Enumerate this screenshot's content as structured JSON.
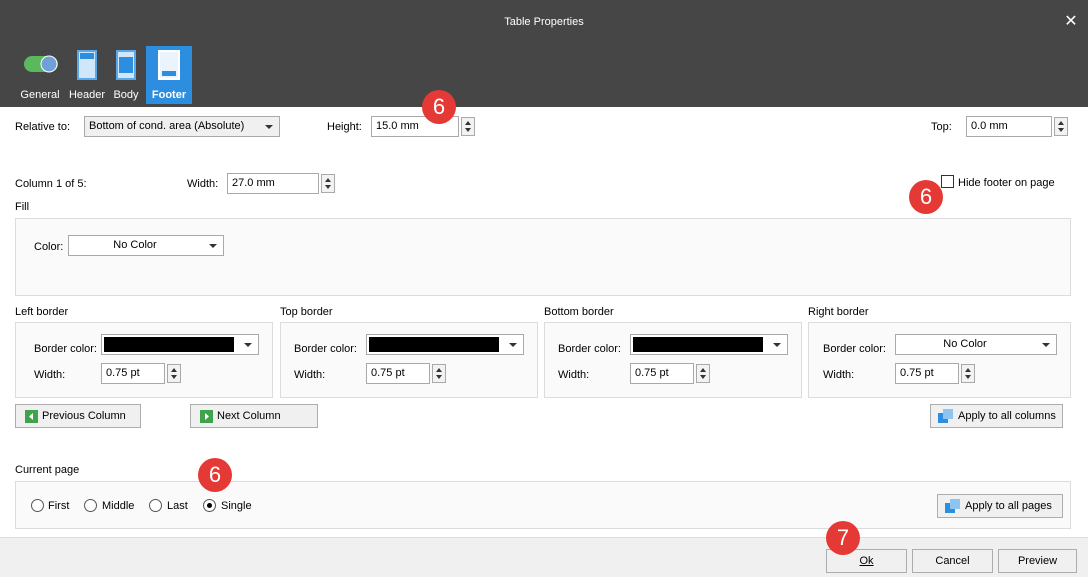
{
  "window": {
    "title": "Table Properties",
    "close_glyph": "✕"
  },
  "tabs": [
    {
      "label": "General",
      "icon": "toggle-icon"
    },
    {
      "label": "Header",
      "icon": "header-icon"
    },
    {
      "label": "Body",
      "icon": "body-icon"
    },
    {
      "label": "Footer",
      "icon": "footer-icon",
      "active": true
    }
  ],
  "footer": {
    "relative_label": "Relative to:",
    "relative_value": "Bottom of cond. area (Absolute)",
    "height_label": "Height:",
    "height_value": "15.0 mm",
    "top_label": "Top:",
    "top_value": "0.0 mm",
    "column_label": "Column 1 of 5:",
    "width_label": "Width:",
    "width_value": "27.0 mm",
    "hide_footer_label": "Hide footer on page"
  },
  "fill": {
    "title": "Fill",
    "color_label": "Color:",
    "color_value": "No Color"
  },
  "borders": {
    "left": {
      "title": "Left border",
      "color_label": "Border color:",
      "color_value": "",
      "width_label": "Width:",
      "width_value": "0.75 pt"
    },
    "top": {
      "title": "Top  border",
      "color_label": "Border color:",
      "color_value": "",
      "width_label": "Width:",
      "width_value": "0.75 pt"
    },
    "bottom": {
      "title": "Bottom border",
      "color_label": "Border color:",
      "color_value": "",
      "width_label": "Width:",
      "width_value": "0.75 pt"
    },
    "right": {
      "title": "Right border",
      "color_label": "Border color:",
      "color_value": "No Color",
      "width_label": "Width:",
      "width_value": "0.75 pt"
    }
  },
  "nav": {
    "prev_label": "Previous Column",
    "next_label": "Next Column",
    "apply_columns_label": "Apply to all columns"
  },
  "current_page": {
    "title": "Current page",
    "options": [
      "First",
      "Middle",
      "Last",
      "Single"
    ],
    "selected": "Single",
    "apply_pages_label": "Apply to all pages"
  },
  "badges": {
    "height": "6",
    "hide": "6",
    "page": "6",
    "ok": "7"
  },
  "buttons": {
    "ok": "Ok",
    "cancel": "Cancel",
    "preview": "Preview"
  },
  "colors": {
    "titlebar": "#464646",
    "active_tab": "#2d8ee0",
    "badge": "#e53935"
  }
}
